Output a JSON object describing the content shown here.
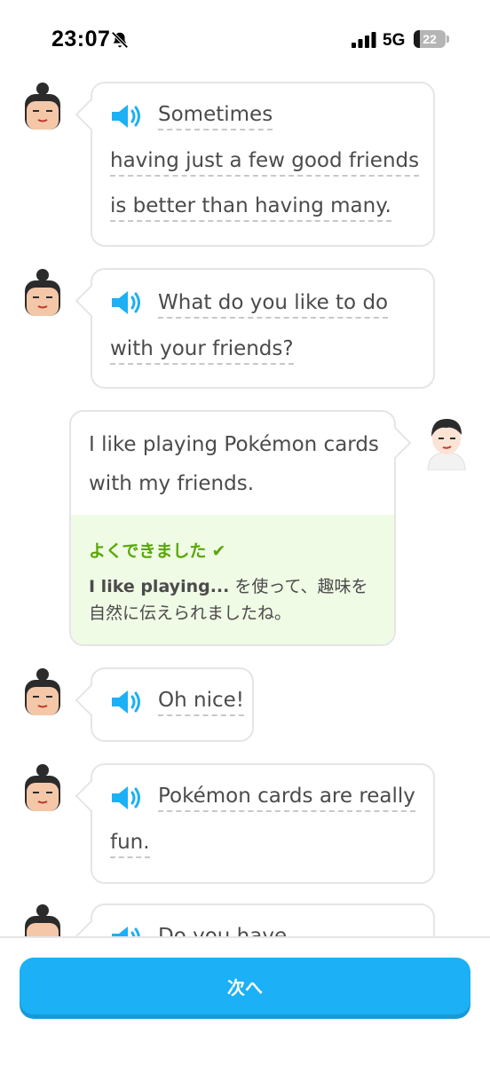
{
  "status_bar": {
    "time": "23:07",
    "network": "5G",
    "battery": "22",
    "icons": [
      "bell-muted-icon",
      "signal-icon",
      "battery-icon"
    ]
  },
  "chat": {
    "messages": [
      {
        "speaker": "character",
        "lines": [
          "Sometimes",
          "having just a few good friends",
          "is better than having many."
        ]
      },
      {
        "speaker": "character",
        "lines": [
          "What do you like to do",
          "with your friends?"
        ]
      },
      {
        "speaker": "user",
        "lines": [
          "I like playing Pokémon cards",
          "with my friends."
        ],
        "feedback": {
          "title": "よくできました",
          "bold": "I like playing...",
          "text_1": " を使って、趣味を",
          "text_2": "自然に伝えられましたね。"
        }
      },
      {
        "speaker": "character",
        "lines": [
          "Oh nice!"
        ]
      },
      {
        "speaker": "character",
        "lines": [
          "Pokémon cards are really",
          "fun."
        ]
      },
      {
        "speaker": "character",
        "lines": [
          "Do you have"
        ]
      }
    ]
  },
  "footer": {
    "next_label": "次へ"
  },
  "colors": {
    "accent": "#1cb0f6",
    "success": "#58a700",
    "success_bg": "#f0fbe6",
    "border": "#e5e5e5"
  }
}
